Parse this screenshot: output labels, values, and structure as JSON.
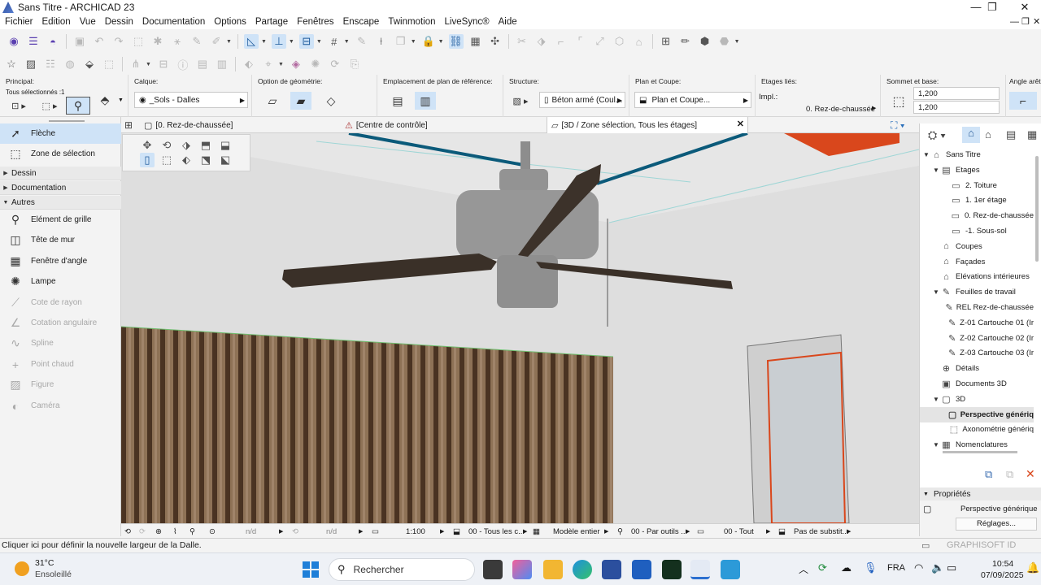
{
  "window": {
    "title": "Sans Titre - ARCHICAD 23"
  },
  "menu": [
    "Fichier",
    "Edition",
    "Vue",
    "Dessin",
    "Documentation",
    "Options",
    "Partage",
    "Fenêtres",
    "Enscape",
    "Twinmotion",
    "LiveSync®",
    "Aide"
  ],
  "infobox": {
    "principal_label": "Principal:",
    "selection_text": "Tous sélectionnés :1",
    "calque_label": "Calque:",
    "calque_value": "_Sols - Dalles",
    "geometrie_label": "Option de géométrie:",
    "emplacement_label": "Emplacement de plan de référence:",
    "structure_label": "Structure:",
    "structure_value": "Béton armé (Coul...",
    "plan_coupe_label": "Plan et Coupe:",
    "plan_coupe_value": "Plan et Coupe...",
    "etages_lies_label": "Etages liés:",
    "impl_label": "Impl.:",
    "impl_value": "0. Rez-de-chaussée",
    "sommet_label": "Sommet et base:",
    "sommet_value": "1,200",
    "base_value": "1,200",
    "angle_label": "Angle arête"
  },
  "toolbox": {
    "tools_top": [
      {
        "label": "Flèche",
        "icon": "arrow-icon"
      },
      {
        "label": "Zone de sélection",
        "icon": "marquee-icon"
      }
    ],
    "sections": [
      "Dessin",
      "Documentation",
      "Autres"
    ],
    "tools_autres": [
      {
        "label": "Elément de grille",
        "icon": "grid-element-icon",
        "enabled": true
      },
      {
        "label": "Tête de mur",
        "icon": "wall-end-icon",
        "enabled": true
      },
      {
        "label": "Fenêtre d'angle",
        "icon": "corner-window-icon",
        "enabled": true
      },
      {
        "label": "Lampe",
        "icon": "lamp-icon",
        "enabled": true
      },
      {
        "label": "Cote de rayon",
        "icon": "radial-dimension-icon",
        "enabled": false
      },
      {
        "label": "Cotation angulaire",
        "icon": "angle-dimension-icon",
        "enabled": false
      },
      {
        "label": "Spline",
        "icon": "spline-icon",
        "enabled": false
      },
      {
        "label": "Point chaud",
        "icon": "hotspot-icon",
        "enabled": false
      },
      {
        "label": "Figure",
        "icon": "figure-icon",
        "enabled": false
      },
      {
        "label": "Caméra",
        "icon": "camera-icon",
        "enabled": false
      }
    ]
  },
  "tabs": [
    {
      "label": "[0. Rez-de-chaussée]",
      "icon": "floorplan-icon"
    },
    {
      "label": "[Centre de contrôle]",
      "icon": "control-center-icon"
    },
    {
      "label": "[3D / Zone sélection, Tous les étages]",
      "icon": "3d-view-icon"
    }
  ],
  "navigator": {
    "items": [
      {
        "label": "Sans Titre",
        "level": 0,
        "toggle": "▼",
        "icon": "project-icon"
      },
      {
        "label": "Etages",
        "level": 1,
        "toggle": "▼",
        "icon": "stories-icon"
      },
      {
        "label": "2. Toiture",
        "level": 2,
        "toggle": "",
        "icon": "story-icon"
      },
      {
        "label": "1. 1er étage",
        "level": 2,
        "toggle": "",
        "icon": "story-icon"
      },
      {
        "label": "0. Rez-de-chaussée",
        "level": 2,
        "toggle": "",
        "icon": "story-icon"
      },
      {
        "label": "-1. Sous-sol",
        "level": 2,
        "toggle": "",
        "icon": "story-icon"
      },
      {
        "label": "Coupes",
        "level": 1,
        "toggle": "",
        "icon": "section-icon"
      },
      {
        "label": "Façades",
        "level": 1,
        "toggle": "",
        "icon": "elevation-icon"
      },
      {
        "label": "Elévations intérieures",
        "level": 1,
        "toggle": "",
        "icon": "interior-elevation-icon"
      },
      {
        "label": "Feuilles de travail",
        "level": 1,
        "toggle": "▼",
        "icon": "worksheet-icon"
      },
      {
        "label": "REL Rez-de-chaussée",
        "level": 2,
        "toggle": "",
        "icon": "worksheet-icon"
      },
      {
        "label": "Z-01 Cartouche 01 (Ir",
        "level": 2,
        "toggle": "",
        "icon": "worksheet-icon"
      },
      {
        "label": "Z-02 Cartouche 02 (Ir",
        "level": 2,
        "toggle": "",
        "icon": "worksheet-icon"
      },
      {
        "label": "Z-03 Cartouche 03 (Ir",
        "level": 2,
        "toggle": "",
        "icon": "worksheet-icon"
      },
      {
        "label": "Détails",
        "level": 1,
        "toggle": "",
        "icon": "details-icon"
      },
      {
        "label": "Documents 3D",
        "level": 1,
        "toggle": "",
        "icon": "3d-document-icon"
      },
      {
        "label": "3D",
        "level": 1,
        "toggle": "▼",
        "icon": "3d-icon"
      },
      {
        "label": "Perspective génériq",
        "level": 2,
        "toggle": "",
        "icon": "perspective-icon",
        "selected": true
      },
      {
        "label": "Axonométrie génériq",
        "level": 2,
        "toggle": "",
        "icon": "axonometry-icon"
      },
      {
        "label": "Nomenclatures",
        "level": 1,
        "toggle": "▼",
        "icon": "schedule-icon"
      }
    ]
  },
  "properties": {
    "header": "Propriétés",
    "view_name": "Perspective générique",
    "settings_button": "Réglages..."
  },
  "viewbar": {
    "nd1": "n/d",
    "nd2": "n/d",
    "scale": "1:100",
    "layer_combo": "00 - Tous les c...",
    "model_view": "Modèle entier",
    "pen_set": "00 - Par outils ...",
    "graphic_override": "00 - Tout",
    "renovation": "Pas de substit..."
  },
  "status": {
    "message": "Cliquer ici pour définir la nouvelle largeur de la Dalle.",
    "brand": "GRAPHISOFT ID"
  },
  "taskbar": {
    "temperature": "31°C",
    "weather": "Ensoleillé",
    "search_label": "Rechercher",
    "language": "FRA",
    "time": "10:54",
    "date": "07/09/2025"
  },
  "colors": {
    "accent": "#0b5a7a",
    "selection": "#cfe3f7",
    "orange_ceiling": "#d9471c"
  }
}
